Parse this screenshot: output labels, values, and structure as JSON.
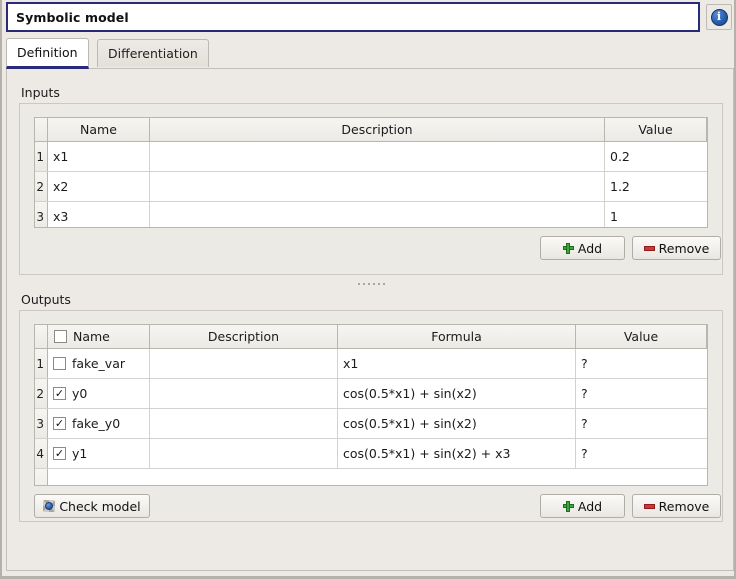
{
  "window": {
    "title": "Symbolic model",
    "info_icon": "info-icon",
    "info_glyph": "i"
  },
  "tabs": [
    {
      "label": "Definition",
      "selected": true
    },
    {
      "label": "Differentiation",
      "selected": false
    }
  ],
  "inputs": {
    "group_label": "Inputs",
    "columns": [
      "Name",
      "Description",
      "Value"
    ],
    "rows": [
      {
        "num": "1",
        "name": "x1",
        "description": "",
        "value": "0.2"
      },
      {
        "num": "2",
        "name": "x2",
        "description": "",
        "value": "1.2"
      },
      {
        "num": "3",
        "name": "x3",
        "description": "",
        "value": "1"
      }
    ],
    "add_label": "Add",
    "remove_label": "Remove"
  },
  "outputs": {
    "group_label": "Outputs",
    "columns": [
      "Name",
      "Description",
      "Formula",
      "Value"
    ],
    "header_checked": false,
    "rows": [
      {
        "num": "1",
        "checked": false,
        "name": "fake_var",
        "description": "",
        "formula": "x1",
        "value": "?"
      },
      {
        "num": "2",
        "checked": true,
        "name": "y0",
        "description": "",
        "formula": "cos(0.5*x1) + sin(x2)",
        "value": "?"
      },
      {
        "num": "3",
        "checked": true,
        "name": "fake_y0",
        "description": "",
        "formula": "cos(0.5*x1) + sin(x2)",
        "value": "?"
      },
      {
        "num": "4",
        "checked": true,
        "name": "y1",
        "description": "",
        "formula": "cos(0.5*x1) + sin(x2) + x3",
        "value": "?"
      }
    ],
    "check_model_label": "Check model",
    "check_model_icon": "gear-icon",
    "add_label": "Add",
    "remove_label": "Remove"
  },
  "colors": {
    "accent": "#2a2a7a",
    "window_bg": "#edeae5",
    "table_bg": "#ffffff",
    "add_green": "#3da83d",
    "remove_red": "#d03636",
    "info_blue": "#2b5fae"
  },
  "check_mark": "✓"
}
